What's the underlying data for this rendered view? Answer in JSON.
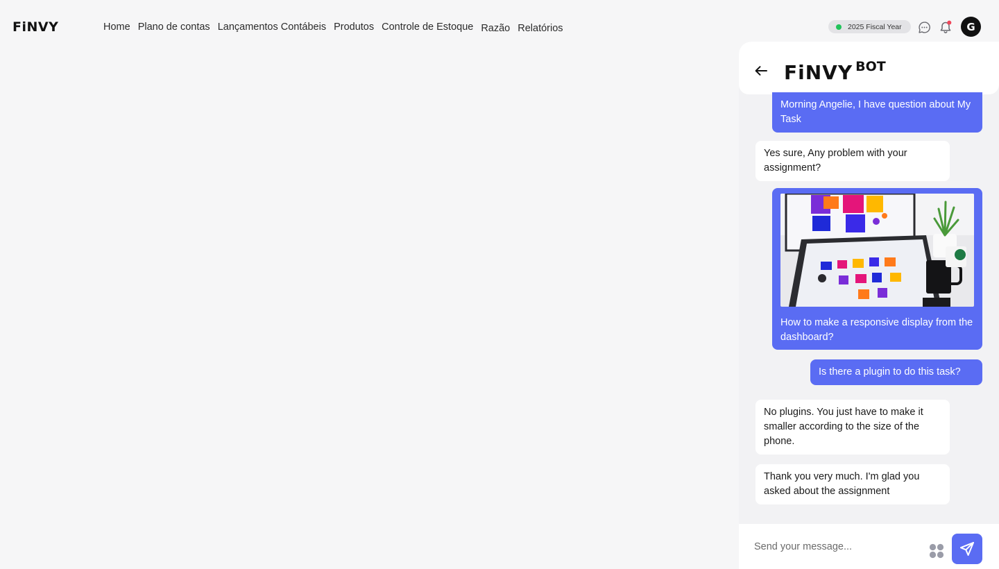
{
  "app": {
    "logo": "FiNVY"
  },
  "nav": {
    "items": [
      {
        "label": "Home"
      },
      {
        "label": "Plano de contas"
      },
      {
        "label": "Lançamentos Contábeis"
      },
      {
        "label": "Produtos"
      },
      {
        "label": "Controle de Estoque"
      },
      {
        "label": "Razão"
      },
      {
        "label": "Relatórios"
      }
    ]
  },
  "header": {
    "fiscal_year": "2025 Fiscal Year",
    "fiscal_status_color": "#21c35a",
    "chat_icon": "chat-bubble-icon",
    "notification_icon": "bell-icon",
    "notification_dot_color": "#f0465a",
    "avatar_initial": "G"
  },
  "chat": {
    "brand": "FiNVY",
    "brand_suffix": "BOT",
    "back_icon": "arrow-left-icon",
    "accent": "#5a6cf3",
    "messages": [
      {
        "from": "user",
        "text": "Morning Angelie, I have question about My Task"
      },
      {
        "from": "bot",
        "text": "Yes sure, Any problem with your assignment?"
      },
      {
        "from": "user",
        "text": "How to make a responsive display from the dashboard?",
        "has_image": true
      },
      {
        "from": "user",
        "text": "Is there a plugin to do this task?"
      },
      {
        "from": "bot",
        "text": "No plugins. You just have to make it smaller according to the size of the phone."
      },
      {
        "from": "bot",
        "text": "Thank you very much. I'm glad you asked about the assignment"
      }
    ],
    "composer": {
      "placeholder": "Send your message...",
      "apps_icon": "grid-apps-icon",
      "send_icon": "send-paper-plane-icon"
    }
  }
}
